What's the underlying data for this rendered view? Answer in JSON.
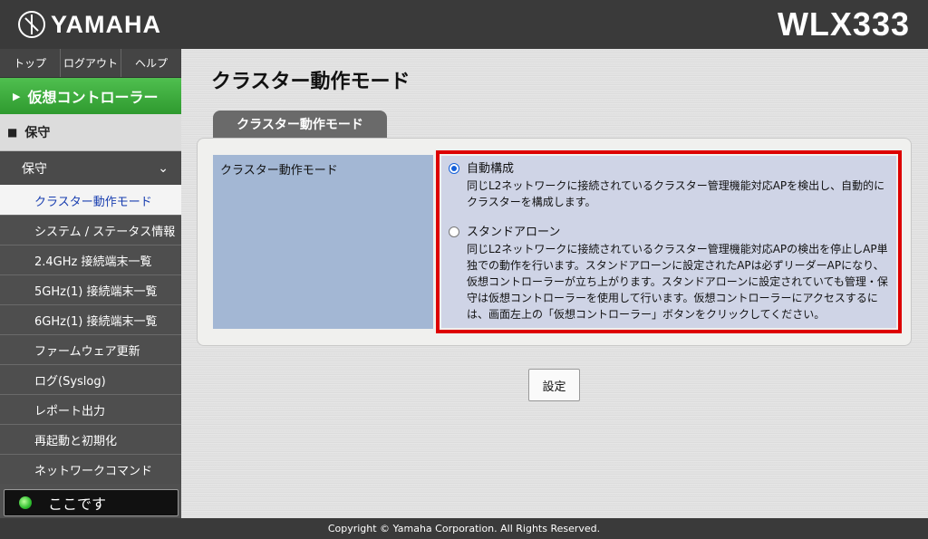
{
  "header": {
    "brand": "YAMAHA",
    "model": "WLX333"
  },
  "sidebar": {
    "topnav": [
      "トップ",
      "ログアウト",
      "ヘルプ"
    ],
    "virtual_controller": "仮想コントローラー",
    "maintenance_header": "保守",
    "maintenance_sub": "保守",
    "items": [
      "クラスター動作モード",
      "システム / ステータス情報",
      "2.4GHz 接続端末一覧",
      "5GHz(1) 接続端末一覧",
      "6GHz(1) 接続端末一覧",
      "ファームウェア更新",
      "ログ(Syslog)",
      "レポート出力",
      "再起動と初期化",
      "ネットワークコマンド"
    ],
    "here_button": "ここです"
  },
  "main": {
    "title": "クラスター動作モード",
    "tab": "クラスター動作モード",
    "row_label": "クラスター動作モード",
    "options": [
      {
        "label": "自動構成",
        "desc_lines": [
          "同じL2ネットワークに接続されているクラスター管理機能対応APを検出し、自動的に",
          "クラスターを構成します。"
        ],
        "selected": true
      },
      {
        "label": "スタンドアローン",
        "desc_lines": [
          "同じL2ネットワークに接続されているクラスター管理機能対応APの検出を停止しAP単",
          "独での動作を行います。スタンドアローンに設定されたAPは必ずリーダーAPになり、",
          "仮想コントローラーが立ち上がります。スタンドアローンに設定されていても管理・保",
          "守は仮想コントローラーを使用して行います。仮想コントローラーにアクセスするに",
          "は、画面左上の「仮想コントローラー」ボタンをクリックしてください。"
        ],
        "selected": false
      }
    ],
    "submit": "設定"
  },
  "footer": {
    "copyright": "Copyright © Yamaha Corporation. All Rights Reserved."
  }
}
